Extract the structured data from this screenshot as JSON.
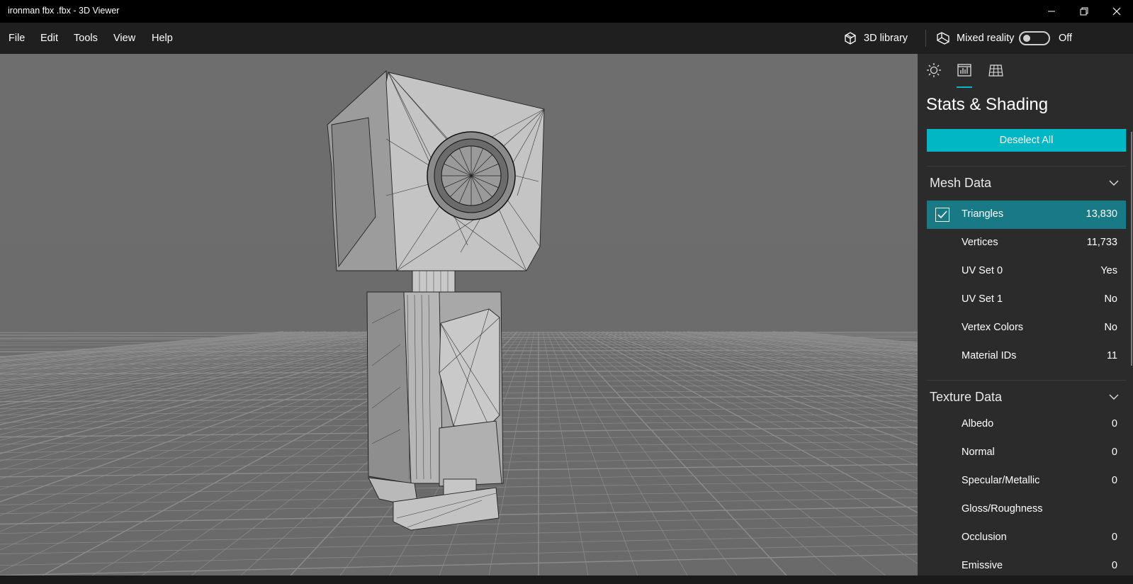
{
  "window": {
    "title": "ironman fbx .fbx - 3D Viewer",
    "controls": [
      "minimize-icon",
      "restore-icon",
      "close-icon"
    ]
  },
  "menu": {
    "items": [
      "File",
      "Edit",
      "Tools",
      "View",
      "Help"
    ],
    "library_label": "3D library",
    "mixed_reality_label": "Mixed reality",
    "mixed_reality_state": "Off"
  },
  "panel": {
    "tabs": [
      "sun-icon",
      "stats-icon",
      "grid-icon"
    ],
    "active_tab": "stats-icon",
    "title": "Stats & Shading",
    "deselect_label": "Deselect All",
    "accent_color": "#00b7c3",
    "selected_row_color": "#177a85",
    "mesh_section": {
      "label": "Mesh Data",
      "rows": [
        {
          "label": "Triangles",
          "value": "13,830",
          "checked": true
        },
        {
          "label": "Vertices",
          "value": "11,733"
        },
        {
          "label": "UV Set 0",
          "value": "Yes"
        },
        {
          "label": "UV Set 1",
          "value": "No"
        },
        {
          "label": "Vertex Colors",
          "value": "No"
        },
        {
          "label": "Material IDs",
          "value": "11"
        }
      ]
    },
    "texture_section": {
      "label": "Texture Data",
      "rows": [
        {
          "label": "Albedo",
          "value": "0"
        },
        {
          "label": "Normal",
          "value": "0"
        },
        {
          "label": "Specular/Metallic",
          "value": "0"
        },
        {
          "label": "Gloss/Roughness",
          "value": ""
        },
        {
          "label": "Occlusion",
          "value": "0"
        },
        {
          "label": "Emissive",
          "value": "0"
        }
      ]
    }
  }
}
